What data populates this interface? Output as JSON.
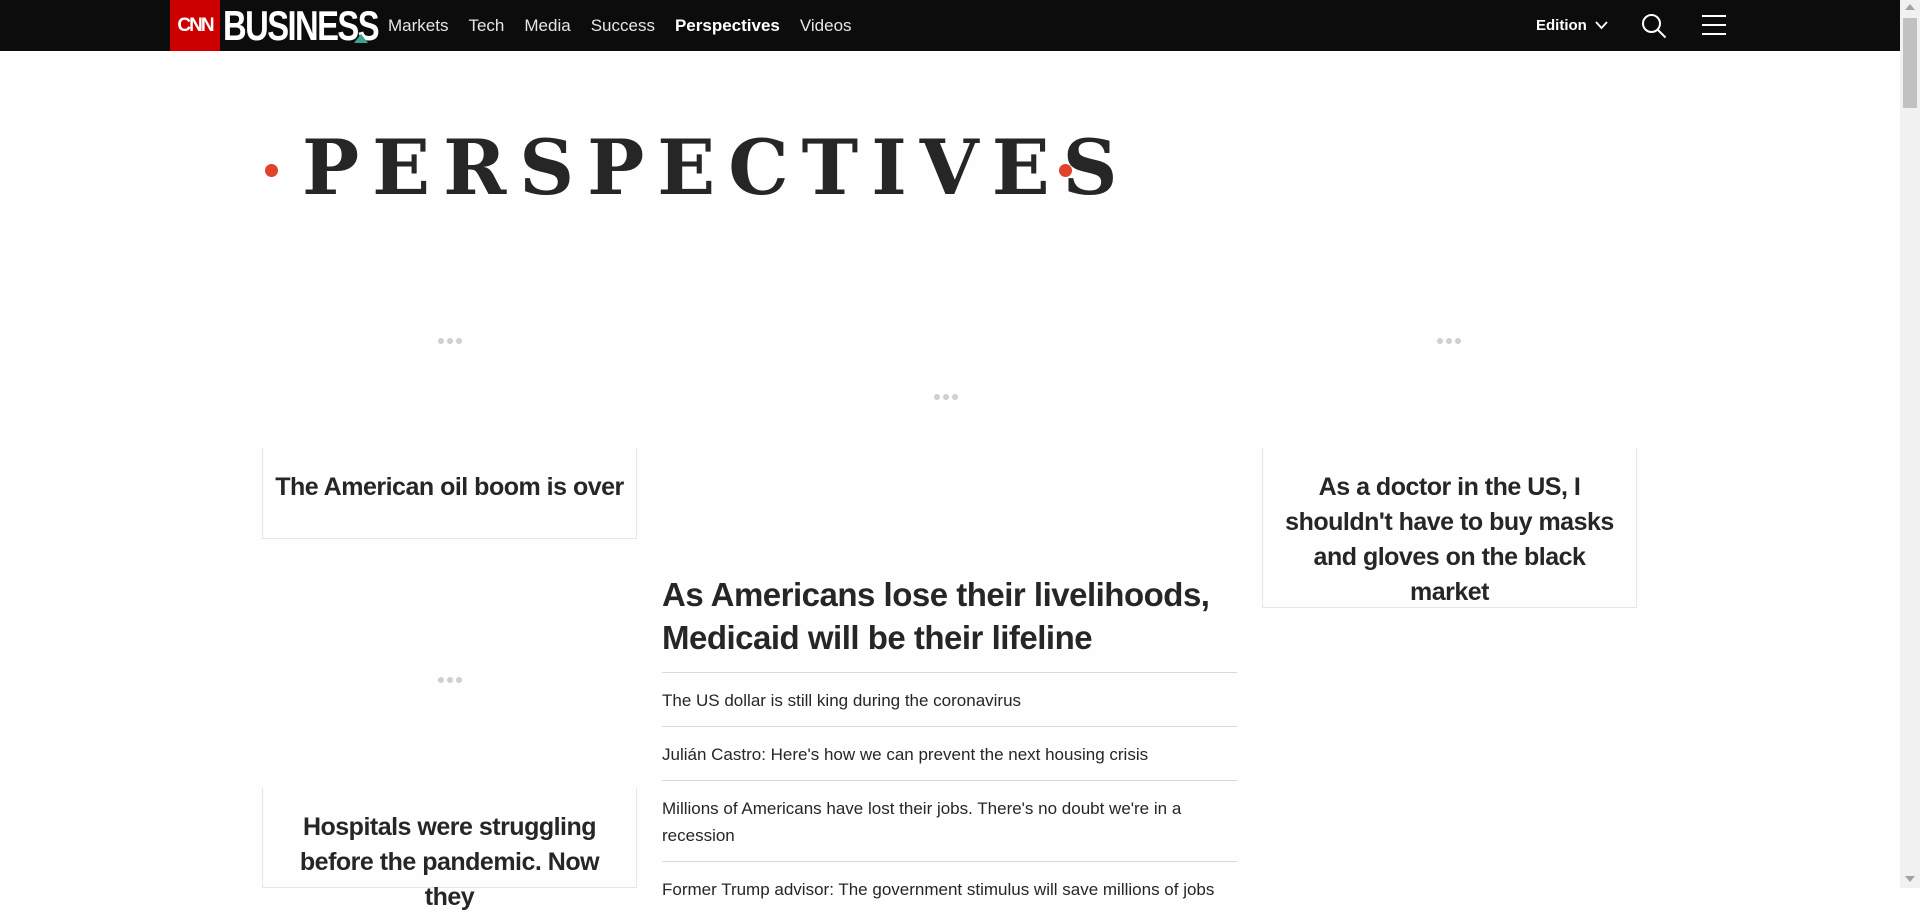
{
  "header": {
    "cnn_logo": "CNN",
    "brand": "BUSINESS",
    "nav": [
      {
        "label": "Markets",
        "active": false
      },
      {
        "label": "Tech",
        "active": false
      },
      {
        "label": "Media",
        "active": false
      },
      {
        "label": "Success",
        "active": false
      },
      {
        "label": "Perspectives",
        "active": true
      },
      {
        "label": "Videos",
        "active": false
      }
    ],
    "edition_label": "Edition",
    "icons": {
      "search": "search-icon",
      "menu": "hamburger-menu-icon",
      "edition": "chevron-down-icon"
    }
  },
  "page": {
    "title": "PERSPECTIVES",
    "accent_color": "#e2412c",
    "nav_bg_color": "#0c0c0c",
    "logo_red": "#cc0000",
    "brand_accent": "#3aa491"
  },
  "left_column": {
    "card1_title": "The American oil boom is over",
    "card2_title": "Hospitals were struggling before the pandemic. Now they"
  },
  "center_column": {
    "main_headline": "As Americans lose their livelihoods, Medicaid will be their lifeline",
    "related": [
      "The US dollar is still king during the coronavirus",
      "Julián Castro: Here's how we can prevent the next housing crisis",
      "Millions of Americans have lost their jobs. There's no doubt we're in a recession",
      "Former Trump advisor: The government stimulus will save millions of jobs"
    ]
  },
  "right_column": {
    "card1_title": "As a doctor in the US, I shouldn't have to buy masks and gloves on the black market"
  }
}
